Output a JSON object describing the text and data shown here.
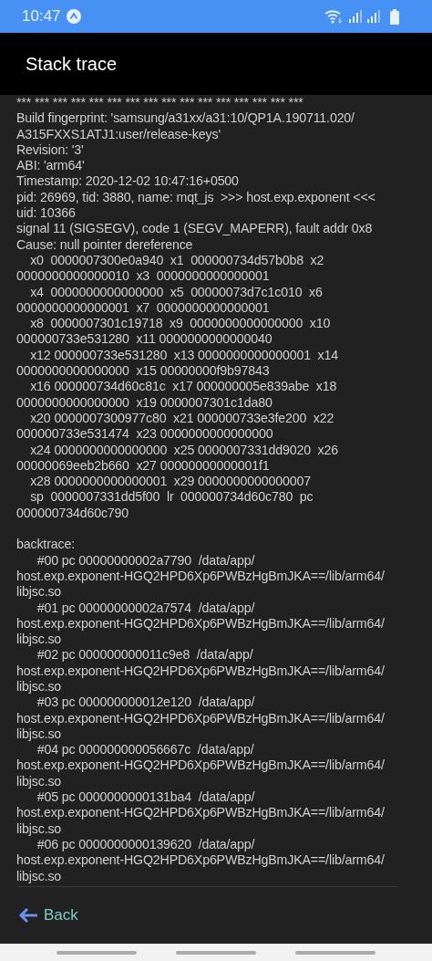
{
  "status_bar": {
    "time": "10:47"
  },
  "app_bar": {
    "title": "Stack trace"
  },
  "trace": {
    "sections": [
      {
        "lines": [
          "*** *** *** *** *** *** *** *** *** *** *** *** *** *** *** ***",
          "Build fingerprint: 'samsung/a31xx/a31:10/QP1A.190711.020/",
          "A315FXXS1ATJ1:user/release-keys'",
          "Revision: '3'",
          "ABI: 'arm64'",
          "Timestamp: 2020-12-02 10:47:16+0500",
          "pid: 26969, tid: 3880, name: mqt_js  >>> host.exp.exponent <<<",
          "uid: 10366",
          "signal 11 (SIGSEGV), code 1 (SEGV_MAPERR), fault addr 0x8",
          "Cause: null pointer dereference",
          "    x0  0000007300e0a940  x1  000000734d57b0b8  x2",
          "0000000000000010  x3  0000000000000001",
          "    x4  0000000000000000  x5  00000073d7c1c010  x6",
          "0000000000000001  x7  0000000000000001",
          "    x8  0000007301c19718  x9  0000000000000000  x10",
          "000000733e531280  x11 0000000000000040",
          "    x12 000000733e531280  x13 0000000000000001  x14",
          "0000000000000000  x15 00000000f9b97843",
          "    x16 000000734d60c81c  x17 000000005e839abe  x18",
          "0000000000000000  x19 0000007301c1da80",
          "    x20 0000007300977c80  x21 000000733e3fe200  x22",
          "000000733e531474  x23 0000000000000000",
          "    x24 0000000000000000  x25 0000007331dd9020  x26",
          "00000069eeb2b660  x27 00000000000001f1",
          "    x28 0000000000000001  x29 0000000000000007",
          "    sp  0000007331dd5f00  lr  000000734d60c780  pc",
          "000000734d60c790"
        ]
      },
      {
        "lines": [
          "backtrace:",
          "      #00 pc 00000000002a7790  /data/app/",
          "host.exp.exponent-HGQ2HPD6Xp6PWBzHgBmJKA==/lib/arm64/",
          "libjsc.so",
          "      #01 pc 00000000002a7574  /data/app/",
          "host.exp.exponent-HGQ2HPD6Xp6PWBzHgBmJKA==/lib/arm64/",
          "libjsc.so",
          "      #02 pc 000000000011c9e8  /data/app/",
          "host.exp.exponent-HGQ2HPD6Xp6PWBzHgBmJKA==/lib/arm64/",
          "libjsc.so",
          "      #03 pc 000000000012e120  /data/app/",
          "host.exp.exponent-HGQ2HPD6Xp6PWBzHgBmJKA==/lib/arm64/",
          "libjsc.so",
          "      #04 pc 000000000056667c  /data/app/",
          "host.exp.exponent-HGQ2HPD6Xp6PWBzHgBmJKA==/lib/arm64/",
          "libjsc.so",
          "      #05 pc 0000000000131ba4  /data/app/",
          "host.exp.exponent-HGQ2HPD6Xp6PWBzHgBmJKA==/lib/arm64/",
          "libjsc.so",
          "      #06 pc 0000000000139620  /data/app/",
          "host.exp.exponent-HGQ2HPD6Xp6PWBzHgBmJKA==/lib/arm64/",
          "libjsc.so"
        ]
      }
    ]
  },
  "footer": {
    "back_label": "Back"
  }
}
